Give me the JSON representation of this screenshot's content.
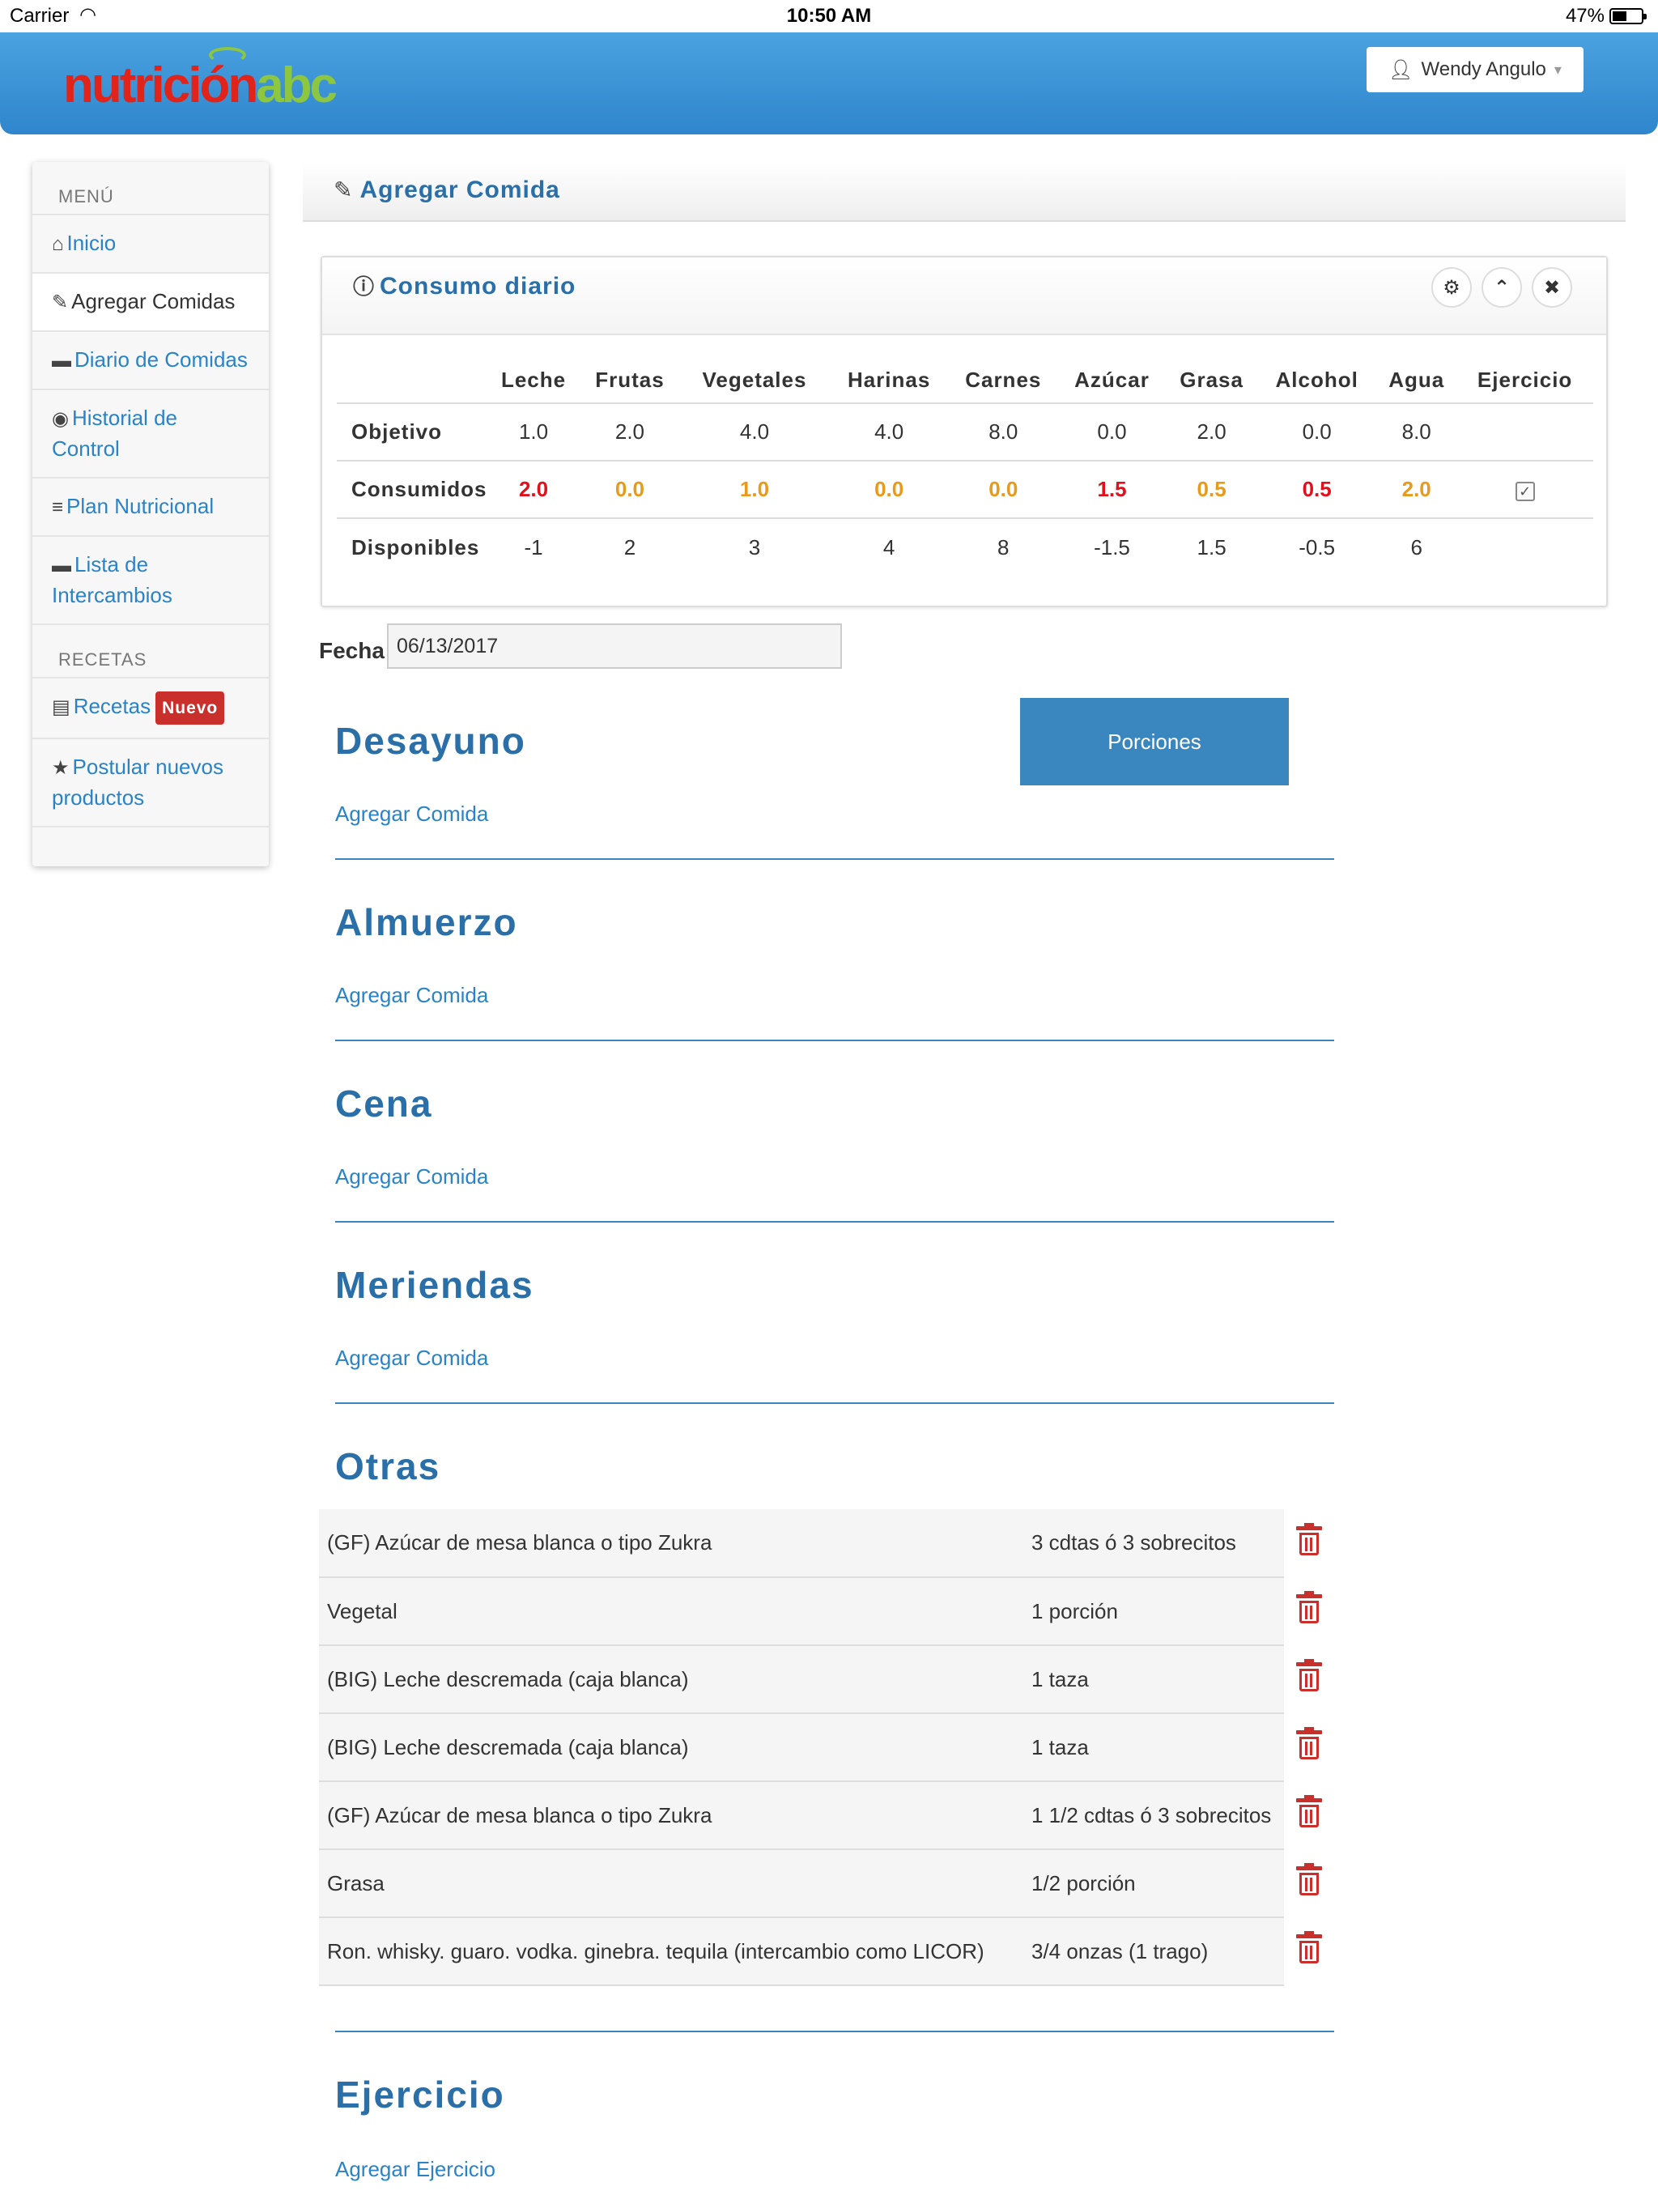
{
  "status": {
    "carrier": "Carrier",
    "time": "10:50 AM",
    "battery": "47%"
  },
  "brand": {
    "part1": "nutrición",
    "part2": "abc"
  },
  "user": {
    "name": "Wendy Angulo"
  },
  "sidebar": {
    "menu_title": "MENÚ",
    "items": [
      {
        "label": "Inicio"
      },
      {
        "label": "Agregar Comidas"
      },
      {
        "label": "Diario de Comidas"
      },
      {
        "label": "Historial de Control"
      },
      {
        "label": "Plan Nutricional"
      },
      {
        "label": "Lista de Intercambios"
      }
    ],
    "recipes_title": "RECETAS",
    "recipes": {
      "label": "Recetas",
      "badge": "Nuevo"
    },
    "postular": {
      "label": "Postular nuevos productos"
    }
  },
  "page_title": "Agregar Comida",
  "consumo": {
    "title": "Consumo diario",
    "columns": [
      "",
      "Leche",
      "Frutas",
      "Vegetales",
      "Harinas",
      "Carnes",
      "Azúcar",
      "Grasa",
      "Alcohol",
      "Agua",
      "Ejercicio"
    ],
    "rows": [
      {
        "label": "Objetivo",
        "values": [
          "1.0",
          "2.0",
          "4.0",
          "4.0",
          "8.0",
          "0.0",
          "2.0",
          "0.0",
          "8.0"
        ]
      },
      {
        "label": "Consumidos",
        "values": [
          "2.0",
          "0.0",
          "1.0",
          "0.0",
          "0.0",
          "1.5",
          "0.5",
          "0.5",
          "2.0"
        ],
        "colors": [
          "red",
          "orange",
          "orange",
          "orange",
          "orange",
          "red",
          "orange",
          "red",
          "orange"
        ],
        "exercise_checked": true
      },
      {
        "label": "Disponibles",
        "values": [
          "-1",
          "2",
          "3",
          "4",
          "8",
          "-1.5",
          "1.5",
          "-0.5",
          "6"
        ]
      }
    ]
  },
  "fecha": {
    "label": "Fecha",
    "value": "06/13/2017"
  },
  "porciones_label": "Porciones",
  "meals": [
    {
      "title": "Desayuno",
      "link": "Agregar Comida"
    },
    {
      "title": "Almuerzo",
      "link": "Agregar Comida"
    },
    {
      "title": "Cena",
      "link": "Agregar Comida"
    },
    {
      "title": "Meriendas",
      "link": "Agregar Comida"
    }
  ],
  "otras": {
    "title": "Otras",
    "items": [
      {
        "name": "(GF) Azúcar de mesa blanca o tipo Zukra",
        "qty": "3 cdtas ó 3 sobrecitos"
      },
      {
        "name": "Vegetal",
        "qty": "1 porción"
      },
      {
        "name": "(BIG) Leche descremada (caja blanca)",
        "qty": "1 taza"
      },
      {
        "name": "(BIG) Leche descremada (caja blanca)",
        "qty": "1 taza"
      },
      {
        "name": "(GF) Azúcar de mesa blanca o tipo Zukra",
        "qty": "1 1/2 cdtas ó 3 sobrecitos"
      },
      {
        "name": "Grasa",
        "qty": "1/2 porción"
      },
      {
        "name": "Ron. whisky. guaro. vodka. ginebra. tequila (intercambio como LICOR)",
        "qty": "3/4 onzas (1 trago)"
      }
    ]
  },
  "ejercicio": {
    "title": "Ejercicio",
    "link": "Agregar Ejercicio"
  },
  "colors": {
    "primary": "#2a6fa8",
    "link": "#2a83c6",
    "red": "#e0101d",
    "orange": "#e89a1c",
    "nav": "#3a92d6"
  }
}
